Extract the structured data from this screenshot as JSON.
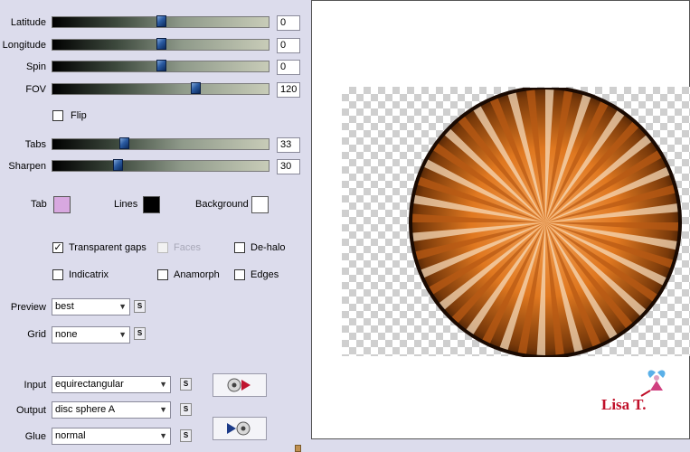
{
  "sliders": [
    {
      "key": "latitude",
      "label": "Latitude",
      "value": "0",
      "fraction": 0.5
    },
    {
      "key": "longitude",
      "label": "Longitude",
      "value": "0",
      "fraction": 0.5
    },
    {
      "key": "spin",
      "label": "Spin",
      "value": "0",
      "fraction": 0.5
    },
    {
      "key": "fov",
      "label": "FOV",
      "value": "120",
      "fraction": 0.66
    },
    {
      "key": "tabs",
      "label": "Tabs",
      "value": "33",
      "fraction": 0.33
    },
    {
      "key": "sharpen",
      "label": "Sharpen",
      "value": "30",
      "fraction": 0.3
    }
  ],
  "flip": {
    "label": "Flip",
    "checked": false
  },
  "colors": {
    "tab_label": "Tab",
    "tab_color": "#d8a8e0",
    "lines_label": "Lines",
    "lines_color": "#000000",
    "background_label": "Background",
    "background_color": "#ffffff"
  },
  "checkboxes": {
    "transparent_gaps": {
      "label": "Transparent gaps",
      "checked": true
    },
    "faces": {
      "label": "Faces",
      "checked": false,
      "disabled": true
    },
    "de_halo": {
      "label": "De-halo",
      "checked": false
    },
    "indicatrix": {
      "label": "Indicatrix",
      "checked": false
    },
    "anamorph": {
      "label": "Anamorph",
      "checked": false
    },
    "edges": {
      "label": "Edges",
      "checked": false
    }
  },
  "preview_select": {
    "label": "Preview",
    "value": "best"
  },
  "grid_select": {
    "label": "Grid",
    "value": "none"
  },
  "input_select": {
    "label": "Input",
    "value": "equirectangular"
  },
  "output_select": {
    "label": "Output",
    "value": "disc sphere A"
  },
  "glue_select": {
    "label": "Glue",
    "value": "normal"
  },
  "s_button_label": "S",
  "signature": {
    "text": "Lisa T."
  },
  "icons": {
    "play_forward": "disc-to-play-icon",
    "play_reverse": "play-to-disc-icon",
    "fairy": "fairy-logo-icon"
  }
}
